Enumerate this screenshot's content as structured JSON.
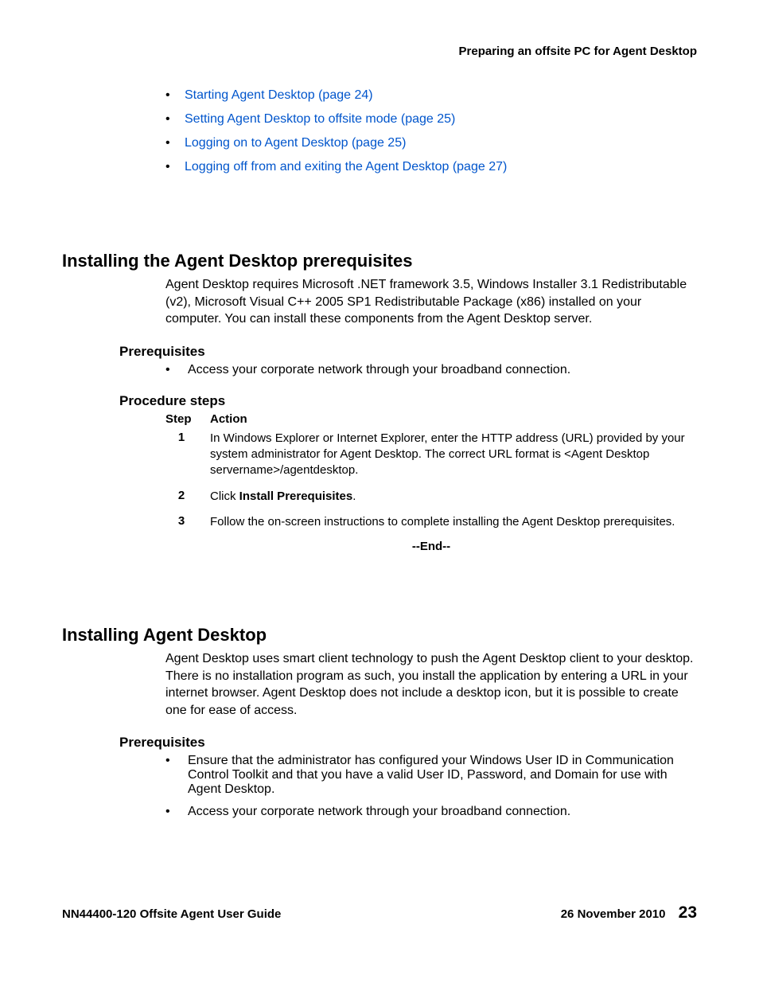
{
  "header": {
    "title": "Preparing an offsite PC for Agent Desktop"
  },
  "top_links": [
    "Starting Agent Desktop (page 24)",
    "Setting Agent Desktop to offsite mode (page 25)",
    "Logging on to Agent Desktop (page 25)",
    "Logging off from and exiting the Agent Desktop (page 27)"
  ],
  "section1": {
    "heading": "Installing the Agent Desktop prerequisites",
    "intro": "Agent Desktop requires Microsoft .NET framework 3.5, Windows Installer 3.1 Redistributable (v2), Microsoft Visual C++ 2005 SP1 Redistributable Package (x86) installed on your computer. You can install these components from the Agent Desktop server.",
    "prereq_heading": "Prerequisites",
    "prereq_items": [
      "Access your corporate network through your broadband connection."
    ],
    "steps_heading": "Procedure steps",
    "steps_head_step": "Step",
    "steps_head_action": "Action",
    "steps": [
      {
        "num": "1",
        "prefix": "In Windows Explorer or Internet Explorer, enter the HTTP address (URL) provided by your system administrator for Agent Desktop. The correct URL format is <Agent Desktop servername>/agentdesktop.",
        "bold": "",
        "suffix": ""
      },
      {
        "num": "2",
        "prefix": "Click ",
        "bold": "Install Prerequisites",
        "suffix": "."
      },
      {
        "num": "3",
        "prefix": "Follow the on-screen instructions to complete installing the Agent Desktop prerequisites.",
        "bold": "",
        "suffix": ""
      }
    ],
    "end": "--End--"
  },
  "section2": {
    "heading": "Installing Agent Desktop",
    "intro": "Agent Desktop uses smart client technology to push the Agent Desktop client to your desktop. There is no installation program as such, you install the application by entering a URL in your internet browser. Agent Desktop does not include a desktop icon, but it is possible to create one for ease of access.",
    "prereq_heading": "Prerequisites",
    "prereq_items": [
      "Ensure that the administrator has configured your Windows User ID in Communication Control Toolkit and that you have a valid User ID, Password, and Domain for use with Agent Desktop.",
      "Access your corporate network through your broadband connection."
    ]
  },
  "footer": {
    "left": "NN44400-120 Offsite Agent User Guide",
    "date": "26 November 2010",
    "page": "23"
  }
}
